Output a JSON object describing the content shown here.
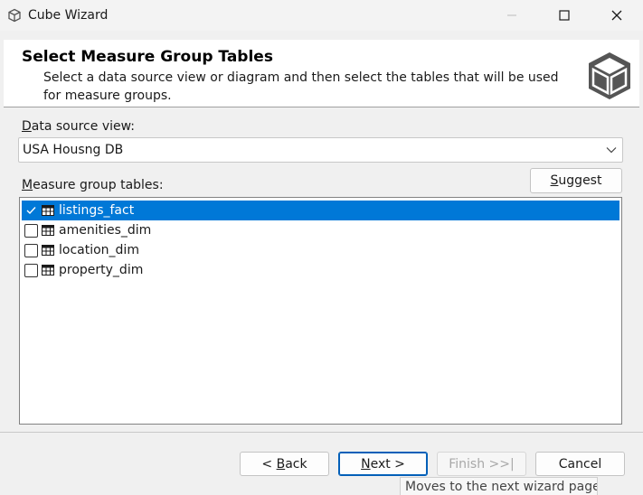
{
  "window": {
    "title": "Cube Wizard",
    "icon": "cube-icon",
    "controls": [
      "minimize-icon",
      "maximize-icon",
      "close-icon"
    ]
  },
  "header": {
    "title": "Select Measure Group Tables",
    "description": "Select a data source view or diagram and then select the tables that will be used for measure groups.",
    "logo": "cube-logo-icon"
  },
  "data_source": {
    "label_prefix": "",
    "label_access": "D",
    "label_rest": "ata source view:",
    "value": "USA Housng DB"
  },
  "measure_tables": {
    "label_access": "M",
    "label_rest": "easure group tables:",
    "suggest_access": "S",
    "suggest_rest": "uggest",
    "items": [
      {
        "label": "listings_fact",
        "checked": true,
        "selected": true
      },
      {
        "label": "amenities_dim",
        "checked": false,
        "selected": false
      },
      {
        "label": "location_dim",
        "checked": false,
        "selected": false
      },
      {
        "label": "property_dim",
        "checked": false,
        "selected": false
      }
    ]
  },
  "footer": {
    "back_pre": "< ",
    "back_access": "B",
    "back_rest": "ack",
    "next_access": "N",
    "next_rest": "ext >",
    "finish_label": "Finish >>|",
    "cancel_label": "Cancel",
    "tooltip": "Moves to the next wizard page"
  },
  "colors": {
    "selection": "#0078d7",
    "default_button_border": "#005fb8"
  }
}
